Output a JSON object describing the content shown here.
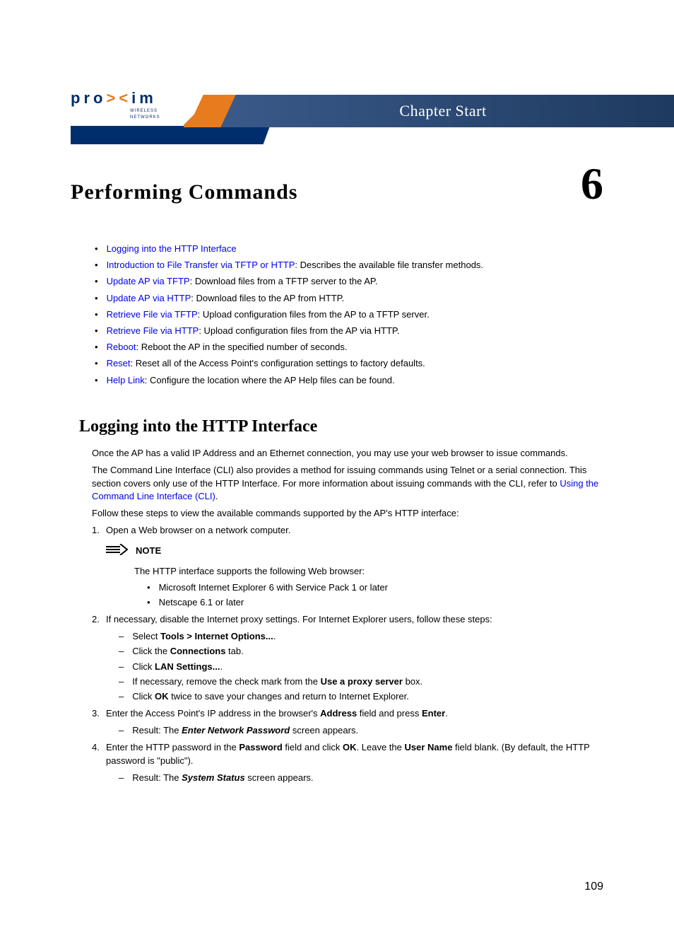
{
  "header": {
    "brand_letters_pre": "pro",
    "brand_letters_post": "im",
    "brand_sub": "WIRELESS NETWORKS",
    "banner": "Chapter Start"
  },
  "chapter": {
    "title": "Performing Commands",
    "number": "6"
  },
  "toc": [
    {
      "link": "Logging into the HTTP Interface",
      "desc": ""
    },
    {
      "link": "Introduction to File Transfer via TFTP or HTTP",
      "desc": ": Describes the available file transfer methods."
    },
    {
      "link": "Update AP via TFTP",
      "desc": ": Download files from a TFTP server to the AP."
    },
    {
      "link": "Update AP via HTTP",
      "desc": ": Download files to the AP from HTTP."
    },
    {
      "link": "Retrieve File via TFTP",
      "desc": ": Upload configuration files from the AP to a TFTP server."
    },
    {
      "link": "Retrieve File via HTTP",
      "desc": ": Upload configuration files from the AP via HTTP."
    },
    {
      "link": "Reboot",
      "desc": ": Reboot the AP in the specified number of seconds."
    },
    {
      "link": "Reset",
      "desc": ": Reset all of the Access Point's configuration settings to factory defaults."
    },
    {
      "link": "Help Link",
      "desc": ": Configure the location where the AP Help files can be found."
    }
  ],
  "section": {
    "heading": "Logging into the HTTP Interface",
    "p1": "Once the AP has a valid IP Address and an Ethernet connection, you may use your web browser to issue commands.",
    "p2_a": "The Command Line Interface (CLI) also provides a method for issuing commands using Telnet or a serial connection. This section covers only use of the HTTP Interface. For more information about issuing commands with the CLI, refer to ",
    "p2_link": "Using the Command Line Interface (CLI)",
    "p2_b": ".",
    "p3": "Follow these steps to view the available commands supported by the AP's HTTP interface:",
    "step1": "Open a Web browser on a network computer.",
    "note_label": "NOTE",
    "note_body": "The HTTP interface supports the following Web browser:",
    "note_bullets": [
      "Microsoft Internet Explorer 6 with Service Pack 1 or later",
      "Netscape 6.1 or later"
    ],
    "step2": "If necessary, disable the Internet proxy settings. For Internet Explorer users, follow these steps:",
    "step2_sub": [
      {
        "pre": "Select ",
        "b": "Tools > Internet Options...",
        "post": "."
      },
      {
        "pre": "Click the ",
        "b": "Connections",
        "post": " tab."
      },
      {
        "pre": "Click ",
        "b": "LAN Settings...",
        "post": "."
      },
      {
        "pre": "If necessary, remove the check mark from the ",
        "b": "Use a proxy server",
        "post": " box."
      },
      {
        "pre": "Click ",
        "b": "OK",
        "post": " twice to save your changes and return to Internet Explorer."
      }
    ],
    "step3_a": "Enter the Access Point's IP address in the browser's ",
    "step3_b1": "Address",
    "step3_c": " field and press ",
    "step3_b2": "Enter",
    "step3_d": ".",
    "step3_result_pre": "Result: The ",
    "step3_result_bi": "Enter Network Password",
    "step3_result_post": " screen appears.",
    "step4_a": "Enter the HTTP password in the ",
    "step4_b1": "Password",
    "step4_b": " field and click ",
    "step4_b2": "OK",
    "step4_c": ". Leave the ",
    "step4_b3": "User Name",
    "step4_d": " field blank. (By default, the HTTP password is \"public\").",
    "step4_result_pre": "Result: The ",
    "step4_result_bi": "System Status",
    "step4_result_post": " screen appears."
  },
  "page_number": "109"
}
